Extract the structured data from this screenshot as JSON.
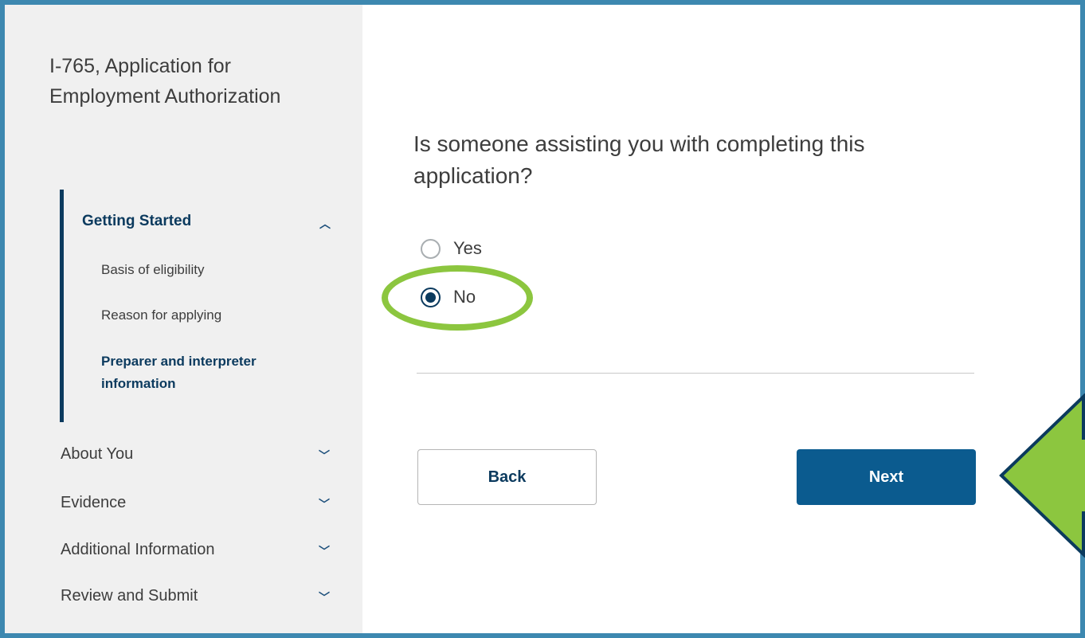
{
  "sidebar": {
    "form_title": "I-765, Application for Employment Authorization",
    "sections": [
      {
        "label": "Getting Started",
        "expanded": true,
        "items": [
          {
            "label": "Basis of eligibility"
          },
          {
            "label": "Reason for applying"
          },
          {
            "label": "Preparer and interpreter information",
            "current": true
          }
        ]
      },
      {
        "label": "About You",
        "expanded": false
      },
      {
        "label": "Evidence",
        "expanded": false
      },
      {
        "label": "Additional Information",
        "expanded": false
      },
      {
        "label": "Review and Submit",
        "expanded": false
      }
    ]
  },
  "main": {
    "question": "Is someone assisting you with completing this application?",
    "options": [
      {
        "label": "Yes",
        "selected": false
      },
      {
        "label": "No",
        "selected": true
      }
    ],
    "back_label": "Back",
    "next_label": "Next"
  },
  "colors": {
    "frame_border": "#3d88b0",
    "sidebar_bg": "#f0f0f0",
    "nav_accent": "#0b3a5e",
    "next_button": "#0b5b8f",
    "annotation_green": "#8cc63f"
  },
  "icons": {
    "expanded": "chevron-up-icon",
    "collapsed": "chevron-down-icon",
    "annotation": "arrow-left-icon"
  }
}
